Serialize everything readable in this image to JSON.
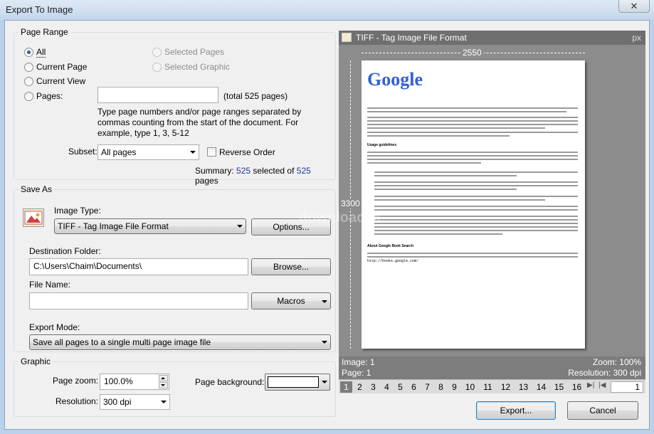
{
  "window": {
    "title": "Export To Image",
    "close_glyph": "✕"
  },
  "page_range": {
    "title": "Page Range",
    "all_label": "All",
    "current_page_label": "Current Page",
    "current_view_label": "Current View",
    "pages_label": "Pages:",
    "pages_input_value": "",
    "total_pages_text": "(total 525 pages)",
    "selected_pages_label": "Selected Pages",
    "selected_graphic_label": "Selected Graphic",
    "hint_line1": "Type page numbers and/or page ranges separated by",
    "hint_line2": "commas counting from the start of the document. For",
    "hint_line3": "example, type 1, 3, 5-12",
    "subset_label": "Subset:",
    "subset_value": "All pages",
    "reverse_order_label": "Reverse Order",
    "summary_prefix": "Summary:",
    "summary_selected": "525",
    "summary_middle": "selected of",
    "summary_total": "525",
    "summary_suffix": "pages"
  },
  "save_as": {
    "title": "Save As",
    "image_type_label": "Image Type:",
    "image_type_value": "TIFF - Tag Image File Format",
    "options_button": "Options...",
    "destination_label": "Destination Folder:",
    "destination_value": "C:\\Users\\Chaim\\Documents\\",
    "browse_button": "Browse...",
    "file_name_label": "File Name:",
    "file_name_value": "",
    "macros_button": "Macros",
    "export_mode_label": "Export Mode:",
    "export_mode_value": "Save all pages to a single multi page image file"
  },
  "graphic": {
    "title": "Graphic",
    "page_zoom_label": "Page zoom:",
    "page_zoom_value": "100.0%",
    "resolution_label": "Resolution:",
    "resolution_value": "300 dpi",
    "page_background_label": "Page background:",
    "page_background_color": "#ffffff"
  },
  "preview": {
    "header_title": "TIFF - Tag Image File Format",
    "unit": "px",
    "width_dim": "2550",
    "height_dim": "3300",
    "image_info": "Image: 1",
    "page_info": "Page: 1",
    "zoom_info": "Zoom: 100%",
    "resolution_info": "Resolution: 300 dpi",
    "page_numbers": [
      "1",
      "2",
      "3",
      "4",
      "5",
      "6",
      "7",
      "8",
      "9",
      "10",
      "11",
      "12",
      "13",
      "14",
      "15",
      "16"
    ],
    "current_page_input": "1",
    "page_text": {
      "logo": "Google",
      "heading1": "Usage guidelines",
      "heading2": "About Google Book Search",
      "url": "http://books.google.com/"
    },
    "watermark": "download3k"
  },
  "buttons": {
    "export": "Export...",
    "cancel": "Cancel"
  },
  "colors": {
    "accent": "#2c628b",
    "summary_number": "#1a3a9a"
  }
}
